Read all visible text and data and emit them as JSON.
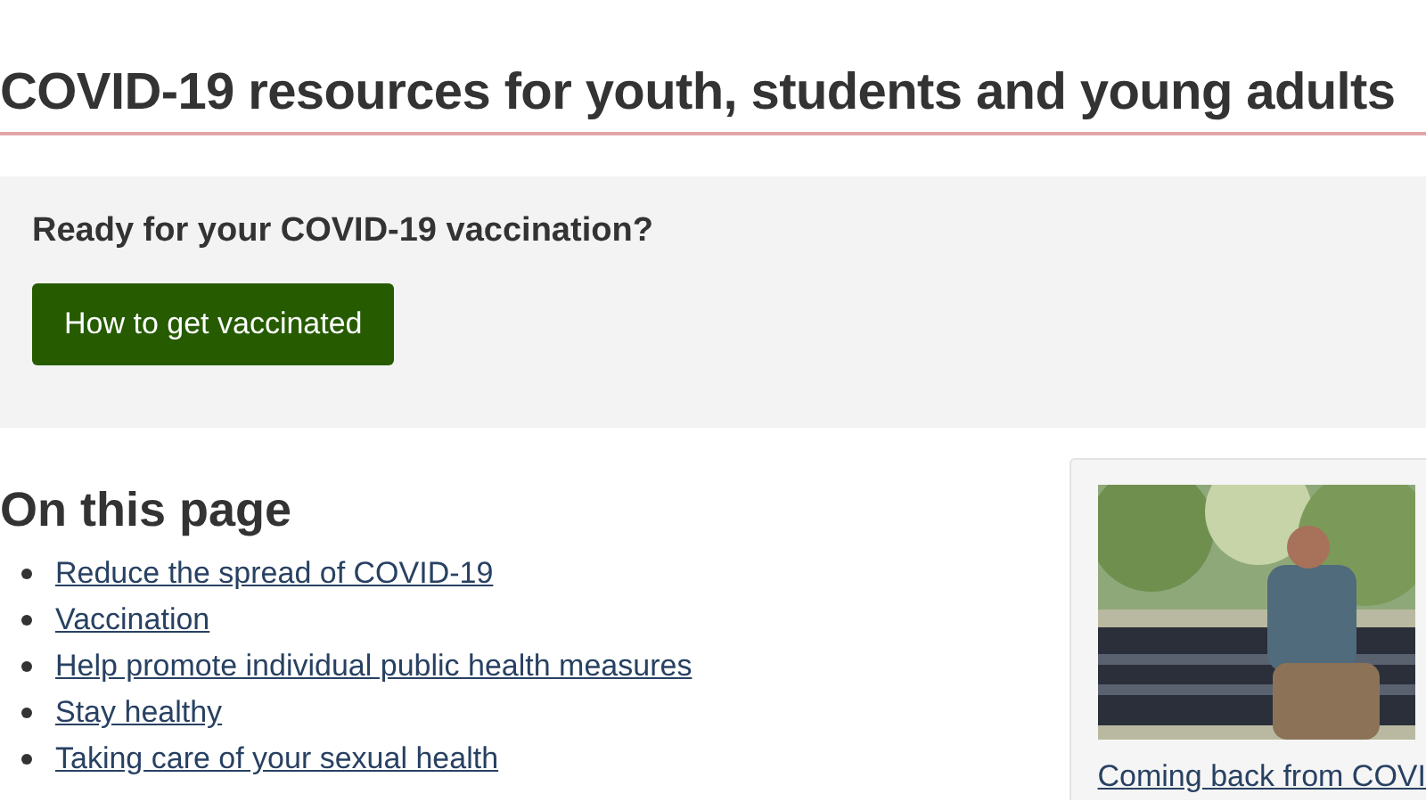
{
  "title": "COVID-19 resources for youth, students and young adults",
  "callout": {
    "heading": "Ready for your COVID-19 vaccination?",
    "button": "How to get vaccinated"
  },
  "on_this_page": {
    "heading": "On this page",
    "links": [
      "Reduce the spread of COVID-19",
      "Vaccination",
      "Help promote individual public health measures",
      "Stay healthy",
      "Taking care of your sexual health"
    ]
  },
  "video_card": {
    "caption": "Coming back from COVI"
  }
}
